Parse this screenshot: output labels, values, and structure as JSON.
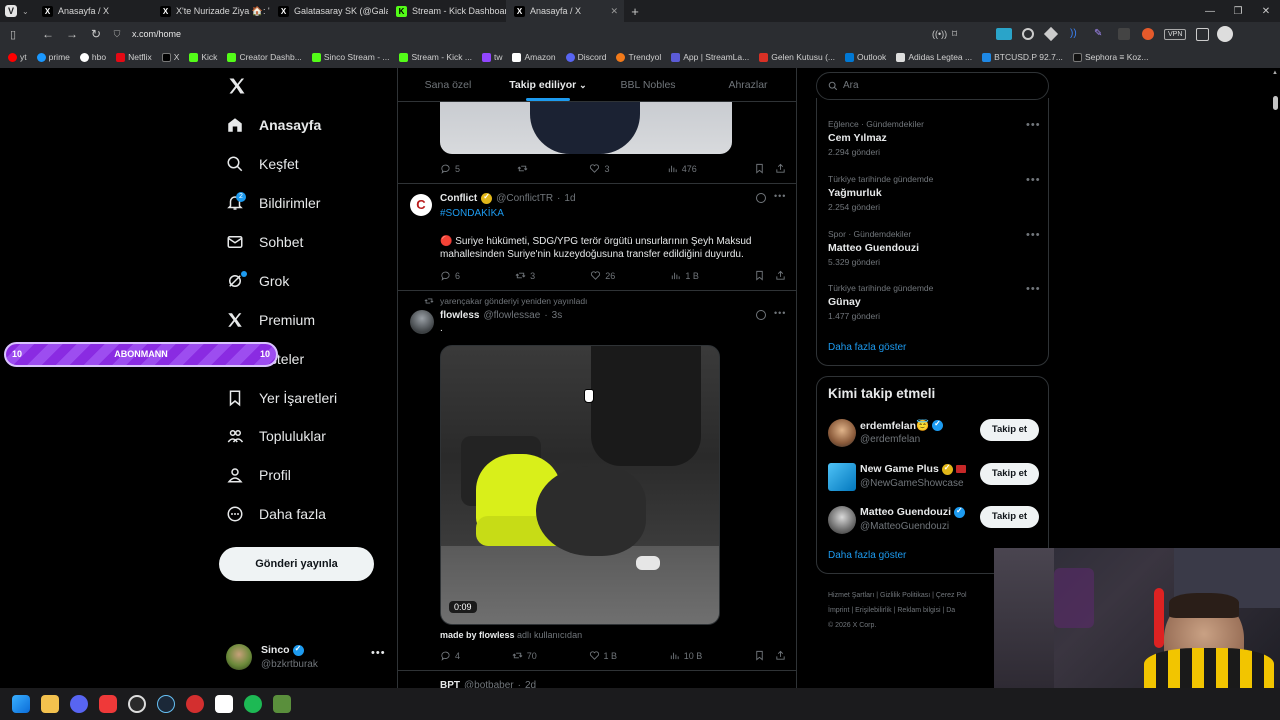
{
  "browser": {
    "tabs": [
      {
        "title": "Anasayfa / X",
        "active": false,
        "badge": "2"
      },
      {
        "title": "X'te Nurizade Ziya 🏠: \"Gal",
        "active": false
      },
      {
        "title": "Galatasaray SK (@Galatasar",
        "active": false
      },
      {
        "title": "Stream - Kick Dashboard",
        "active": false
      },
      {
        "title": "Anasayfa / X",
        "active": true
      }
    ],
    "url": "x.com/home",
    "vpn_label": "VPN",
    "bookmarks": [
      "yt",
      "prime",
      "hbo",
      "Netflix",
      "X",
      "Kick",
      "Creator Dashb...",
      "Sinco Stream - ...",
      "Stream - Kick ...",
      "tw",
      "Amazon",
      "Discord",
      "Trendyol",
      "App | StreamLa...",
      "Gelen Kutusu (...",
      "Outlook",
      "Adidas Legtea ...",
      "BTCUSD.P 92.7...",
      "Sephora ≡ Koz..."
    ]
  },
  "sidebar": {
    "items": [
      {
        "label": "Anasayfa",
        "icon": "home-icon"
      },
      {
        "label": "Keşfet",
        "icon": "search-icon"
      },
      {
        "label": "Bildirimler",
        "icon": "bell-icon",
        "badge": "2"
      },
      {
        "label": "Sohbet",
        "icon": "mail-icon"
      },
      {
        "label": "Grok",
        "icon": "grok-icon"
      },
      {
        "label": "Premium",
        "icon": "x-logo-icon"
      },
      {
        "label": "Listeler",
        "icon": "list-icon"
      },
      {
        "label": "Yer İşaretleri",
        "icon": "bookmark-icon"
      },
      {
        "label": "Topluluklar",
        "icon": "people-icon"
      },
      {
        "label": "Profil",
        "icon": "person-icon"
      },
      {
        "label": "Daha fazla",
        "icon": "more-circle-icon"
      }
    ],
    "post_button": "Gönderi yayınla",
    "account": {
      "name": "Sinco",
      "handle": "@bzkrtburak"
    }
  },
  "overlay": {
    "left_number": "10",
    "label": "ABONMANN",
    "right_number": "10"
  },
  "feed": {
    "tabs": [
      "Sana özel",
      "Takip ediliyor",
      "BBL Nobles",
      "Ahrazlar"
    ],
    "active_tab": "Takip ediliyor",
    "top_post_actions": {
      "replies": "5",
      "reposts": "",
      "likes": "3",
      "views": "476"
    },
    "posts": [
      {
        "author": "Conflict",
        "handle": "@ConflictTR",
        "time": "1d",
        "hashtag": "#SONDAKİKA",
        "text": "🔴 Suriye hükümeti, SDG/YPG terör örgütü unsurlarının Şeyh Maksud mahallesinden Suriye'nin kuzeydoğusuna transfer edildiğini duyurdu.",
        "replies": "6",
        "reposts": "3",
        "likes": "26",
        "views": "1 B"
      },
      {
        "repost_note": "yarençakar gönderiyi yeniden yayınladı",
        "author": "flowless",
        "handle": "@flowlessae",
        "time": "3s",
        "text": ".",
        "video_duration": "0:09",
        "caption_bold": "made by flowless",
        "caption_rest": " adlı kullanıcıdan",
        "replies": "4",
        "reposts": "70",
        "likes": "1 B",
        "views": "10 B"
      },
      {
        "author": "BPT",
        "handle": "@botbaber",
        "time": "2d"
      }
    ]
  },
  "right": {
    "search_placeholder": "Ara",
    "trends": [
      {
        "category": "Eğlence · Gündemdekiler",
        "name": "Cem Yılmaz",
        "count": "2.294 gönderi"
      },
      {
        "category": "Türkiye tarihinde gündemde",
        "name": "Yağmurluk",
        "count": "2.254 gönderi"
      },
      {
        "category": "Spor · Gündemdekiler",
        "name": "Matteo Guendouzi",
        "count": "5.329 gönderi"
      },
      {
        "category": "Türkiye tarihinde gündemde",
        "name": "Günay",
        "count": "1.477 gönderi"
      }
    ],
    "show_more": "Daha fazla göster",
    "who_to_follow_title": "Kimi takip etmeli",
    "who_to_follow": [
      {
        "name": "erdemfelan😇",
        "handle": "@erdemfelan",
        "button": "Takip et",
        "verified": "#1d9bf0"
      },
      {
        "name": "New Game Plus",
        "handle": "@NewGameShowcase",
        "button": "Takip et",
        "verified": "#e2b719"
      },
      {
        "name": "Matteo Guendouzi",
        "handle": "@MatteoGuendouzi",
        "button": "Takip et",
        "verified": "#1d9bf0"
      }
    ],
    "footer_lines": [
      "Hizmet Şartları | Gizlilik Politikası | Çerez Pol",
      "İmprint | Erişilebilirlik | Reklam bilgisi | Da",
      "© 2026 X Corp."
    ]
  },
  "colors": {
    "accent": "#1d9bf0",
    "overlay": "#8a2be2"
  }
}
